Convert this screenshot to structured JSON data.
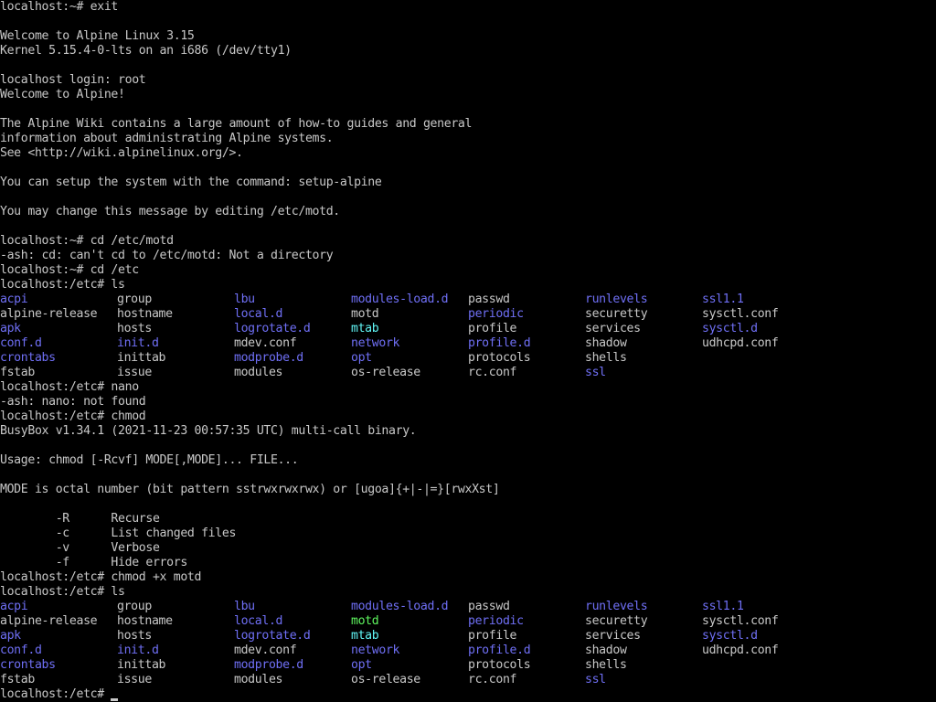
{
  "colors": {
    "background": "#000000",
    "foreground": "#c8c8c8",
    "directory": "#6f6ff5",
    "executable": "#5ef55e",
    "symlink": "#60f5f5"
  },
  "lines": [
    "localhost:~# exit",
    "",
    "Welcome to Alpine Linux 3.15",
    "Kernel 5.15.4-0-lts on an i686 (/dev/tty1)",
    "",
    "localhost login: root",
    "Welcome to Alpine!",
    "",
    "The Alpine Wiki contains a large amount of how-to guides and general",
    "information about administrating Alpine systems.",
    "See <http://wiki.alpinelinux.org/>.",
    "",
    "You can setup the system with the command: setup-alpine",
    "",
    "You may change this message by editing /etc/motd.",
    "",
    "localhost:~# cd /etc/motd",
    "-ash: cd: can't cd to /etc/motd: Not a directory",
    "localhost:~# cd /etc",
    "localhost:/etc# ls"
  ],
  "ls1": [
    [
      {
        "t": "acpi",
        "c": "dir"
      },
      {
        "t": "group",
        "c": "plain"
      },
      {
        "t": "lbu",
        "c": "dir"
      },
      {
        "t": "modules-load.d",
        "c": "dir"
      },
      {
        "t": "passwd",
        "c": "plain"
      },
      {
        "t": "runlevels",
        "c": "dir"
      },
      {
        "t": "ssl1.1",
        "c": "dir"
      }
    ],
    [
      {
        "t": "alpine-release",
        "c": "plain"
      },
      {
        "t": "hostname",
        "c": "plain"
      },
      {
        "t": "local.d",
        "c": "dir"
      },
      {
        "t": "motd",
        "c": "plain"
      },
      {
        "t": "periodic",
        "c": "dir"
      },
      {
        "t": "securetty",
        "c": "plain"
      },
      {
        "t": "sysctl.conf",
        "c": "plain"
      }
    ],
    [
      {
        "t": "apk",
        "c": "dir"
      },
      {
        "t": "hosts",
        "c": "plain"
      },
      {
        "t": "logrotate.d",
        "c": "dir"
      },
      {
        "t": "mtab",
        "c": "cyan"
      },
      {
        "t": "profile",
        "c": "plain"
      },
      {
        "t": "services",
        "c": "plain"
      },
      {
        "t": "sysctl.d",
        "c": "dir"
      }
    ],
    [
      {
        "t": "conf.d",
        "c": "dir"
      },
      {
        "t": "init.d",
        "c": "dir"
      },
      {
        "t": "mdev.conf",
        "c": "plain"
      },
      {
        "t": "network",
        "c": "dir"
      },
      {
        "t": "profile.d",
        "c": "dir"
      },
      {
        "t": "shadow",
        "c": "plain"
      },
      {
        "t": "udhcpd.conf",
        "c": "plain"
      }
    ],
    [
      {
        "t": "crontabs",
        "c": "dir"
      },
      {
        "t": "inittab",
        "c": "plain"
      },
      {
        "t": "modprobe.d",
        "c": "dir"
      },
      {
        "t": "opt",
        "c": "dir"
      },
      {
        "t": "protocols",
        "c": "plain"
      },
      {
        "t": "shells",
        "c": "plain"
      },
      {
        "t": "",
        "c": "plain"
      }
    ],
    [
      {
        "t": "fstab",
        "c": "plain"
      },
      {
        "t": "issue",
        "c": "plain"
      },
      {
        "t": "modules",
        "c": "plain"
      },
      {
        "t": "os-release",
        "c": "plain"
      },
      {
        "t": "rc.conf",
        "c": "plain"
      },
      {
        "t": "ssl",
        "c": "dir"
      },
      {
        "t": "",
        "c": "plain"
      }
    ]
  ],
  "lines2": [
    "localhost:/etc# nano",
    "-ash: nano: not found",
    "localhost:/etc# chmod",
    "BusyBox v1.34.1 (2021-11-23 00:57:35 UTC) multi-call binary.",
    "",
    "Usage: chmod [-Rcvf] MODE[,MODE]... FILE...",
    "",
    "MODE is octal number (bit pattern sstrwxrwxrwx) or [ugoa]{+|-|=}[rwxXst]",
    "",
    "        -R      Recurse",
    "        -c      List changed files",
    "        -v      Verbose",
    "        -f      Hide errors",
    "localhost:/etc# chmod +x motd",
    "localhost:/etc# ls"
  ],
  "ls2": [
    [
      {
        "t": "acpi",
        "c": "dir"
      },
      {
        "t": "group",
        "c": "plain"
      },
      {
        "t": "lbu",
        "c": "dir"
      },
      {
        "t": "modules-load.d",
        "c": "dir"
      },
      {
        "t": "passwd",
        "c": "plain"
      },
      {
        "t": "runlevels",
        "c": "dir"
      },
      {
        "t": "ssl1.1",
        "c": "dir"
      }
    ],
    [
      {
        "t": "alpine-release",
        "c": "plain"
      },
      {
        "t": "hostname",
        "c": "plain"
      },
      {
        "t": "local.d",
        "c": "dir"
      },
      {
        "t": "motd",
        "c": "exe"
      },
      {
        "t": "periodic",
        "c": "dir"
      },
      {
        "t": "securetty",
        "c": "plain"
      },
      {
        "t": "sysctl.conf",
        "c": "plain"
      }
    ],
    [
      {
        "t": "apk",
        "c": "dir"
      },
      {
        "t": "hosts",
        "c": "plain"
      },
      {
        "t": "logrotate.d",
        "c": "dir"
      },
      {
        "t": "mtab",
        "c": "cyan"
      },
      {
        "t": "profile",
        "c": "plain"
      },
      {
        "t": "services",
        "c": "plain"
      },
      {
        "t": "sysctl.d",
        "c": "dir"
      }
    ],
    [
      {
        "t": "conf.d",
        "c": "dir"
      },
      {
        "t": "init.d",
        "c": "dir"
      },
      {
        "t": "mdev.conf",
        "c": "plain"
      },
      {
        "t": "network",
        "c": "dir"
      },
      {
        "t": "profile.d",
        "c": "dir"
      },
      {
        "t": "shadow",
        "c": "plain"
      },
      {
        "t": "udhcpd.conf",
        "c": "plain"
      }
    ],
    [
      {
        "t": "crontabs",
        "c": "dir"
      },
      {
        "t": "inittab",
        "c": "plain"
      },
      {
        "t": "modprobe.d",
        "c": "dir"
      },
      {
        "t": "opt",
        "c": "dir"
      },
      {
        "t": "protocols",
        "c": "plain"
      },
      {
        "t": "shells",
        "c": "plain"
      },
      {
        "t": "",
        "c": "plain"
      }
    ],
    [
      {
        "t": "fstab",
        "c": "plain"
      },
      {
        "t": "issue",
        "c": "plain"
      },
      {
        "t": "modules",
        "c": "plain"
      },
      {
        "t": "os-release",
        "c": "plain"
      },
      {
        "t": "rc.conf",
        "c": "plain"
      },
      {
        "t": "ssl",
        "c": "dir"
      },
      {
        "t": "",
        "c": "plain"
      }
    ]
  ],
  "prompt": {
    "text": "localhost:/etc# ",
    "input_value": ""
  }
}
